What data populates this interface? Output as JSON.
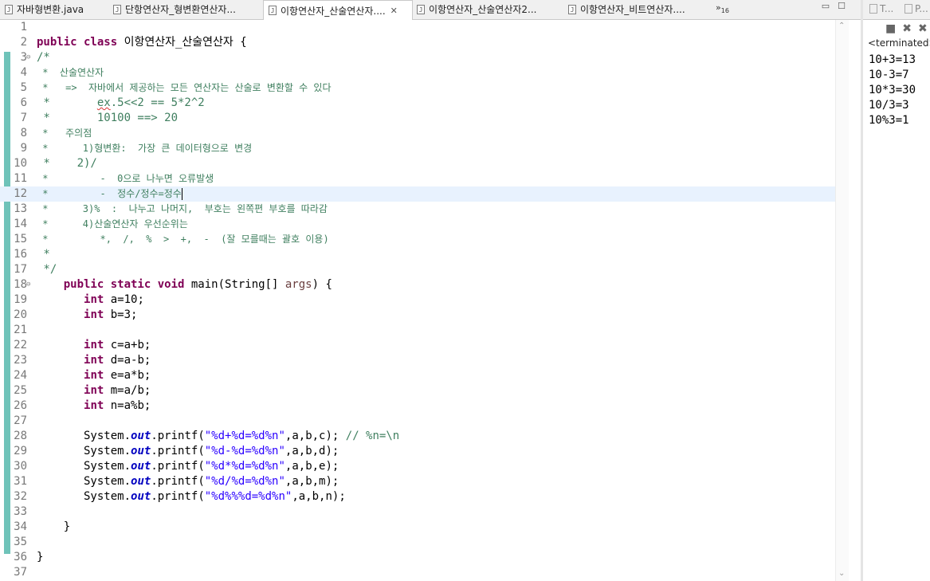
{
  "tabs": [
    {
      "label": "자바형변환.java",
      "icon": "java-file-icon"
    },
    {
      "label": "단항연산자_형변환연산자...",
      "icon": "java-file-icon"
    },
    {
      "label": "이항연산자_산술연산자....",
      "icon": "java-file-icon",
      "active": true
    },
    {
      "label": "이항연산자_산술연산자2...",
      "icon": "java-file-icon"
    },
    {
      "label": "이항연산자_비트연산자....",
      "icon": "java-file-icon"
    }
  ],
  "overflow": {
    "glyph": "»",
    "count": "16"
  },
  "editor": {
    "lines": [
      {
        "n": "1",
        "html": ""
      },
      {
        "n": "2",
        "html": "<span class='kw'>public class</span> 이항연산자_산술연산자 {"
      },
      {
        "n": "3",
        "fold": true,
        "html": "<span class='cm'>/*</span>"
      },
      {
        "n": "4",
        "comment": true,
        "html": "<span class='cm'> *  산술연산자</span>"
      },
      {
        "n": "5",
        "comment": true,
        "html": "<span class='cm'> *   =>  자바에서 제공하는 모든 연산자는 산술로 변환할 수 있다</span>"
      },
      {
        "n": "6",
        "html": "<span class='cm'> *       <span class='spell'>ex</span>.5&lt;&lt;2 == 5*2^2</span>"
      },
      {
        "n": "7",
        "html": "<span class='cm'> *       10100 ==&gt; 20</span>"
      },
      {
        "n": "8",
        "comment": true,
        "html": "<span class='cm'> *   주의점</span>"
      },
      {
        "n": "9",
        "comment": true,
        "html": "<span class='cm'> *      1)형변환:  가장 큰 데이터형으로 변경</span>"
      },
      {
        "n": "10",
        "html": "<span class='cm'> *    2)/</span>"
      },
      {
        "n": "11",
        "comment": true,
        "html": "<span class='cm'> *         -  0으로 나누면 오류발생</span>"
      },
      {
        "n": "12",
        "current": true,
        "comment": true,
        "html": "<span class='cm'> *         -  정수/정수=정수</span><span class='caret'></span>"
      },
      {
        "n": "13",
        "comment": true,
        "html": "<span class='cm'> *      3)%  :  나누고 나머지,  부호는 왼쪽편 부호를 따라감</span>"
      },
      {
        "n": "14",
        "comment": true,
        "html": "<span class='cm'> *      4)산술연산자 우선순위는</span>"
      },
      {
        "n": "15",
        "comment": true,
        "html": "<span class='cm'> *         *,  /,  %  &gt;  +,  -  (잘 모를때는 괄호 이용)</span>"
      },
      {
        "n": "16",
        "html": "<span class='cm'> *</span>"
      },
      {
        "n": "17",
        "html": "<span class='cm'> */</span>"
      },
      {
        "n": "18",
        "fold": true,
        "html": "    <span class='kw'>public static void</span> main(String[] <span class='arg'>args</span>) {"
      },
      {
        "n": "19",
        "html": "       <span class='kw'>int</span> a=10;"
      },
      {
        "n": "20",
        "html": "       <span class='kw'>int</span> b=3;"
      },
      {
        "n": "21",
        "html": ""
      },
      {
        "n": "22",
        "html": "       <span class='kw'>int</span> c=a+b;"
      },
      {
        "n": "23",
        "html": "       <span class='kw'>int</span> d=a-b;"
      },
      {
        "n": "24",
        "html": "       <span class='kw'>int</span> e=a*b;"
      },
      {
        "n": "25",
        "html": "       <span class='kw'>int</span> m=a/b;"
      },
      {
        "n": "26",
        "html": "       <span class='kw'>int</span> n=a%b;"
      },
      {
        "n": "27",
        "html": ""
      },
      {
        "n": "28",
        "html": "       System.<span class='fld'>out</span>.printf(<span class='str'>\"%d+%d=%d%n\"</span>,a,b,c); <span class='cm'>// %n=\\n</span>"
      },
      {
        "n": "29",
        "html": "       System.<span class='fld'>out</span>.printf(<span class='str'>\"%d-%d=%d%n\"</span>,a,b,d);"
      },
      {
        "n": "30",
        "html": "       System.<span class='fld'>out</span>.printf(<span class='str'>\"%d*%d=%d%n\"</span>,a,b,e);"
      },
      {
        "n": "31",
        "html": "       System.<span class='fld'>out</span>.printf(<span class='str'>\"%d/%d=%d%n\"</span>,a,b,m);"
      },
      {
        "n": "32",
        "html": "       System.<span class='fld'>out</span>.printf(<span class='str'>\"%d%%%d=%d%n\"</span>,a,b,n);"
      },
      {
        "n": "33",
        "html": ""
      },
      {
        "n": "34",
        "html": "    }"
      },
      {
        "n": "35",
        "html": ""
      },
      {
        "n": "36",
        "html": "}"
      },
      {
        "n": "37",
        "html": ""
      }
    ]
  },
  "console": {
    "tabs": [
      {
        "label": "T..."
      },
      {
        "label": "P..."
      }
    ],
    "status": "<terminated>",
    "output": [
      "10+3=13",
      "10-3=7",
      "10*3=30",
      "10/3=3",
      "10%3=1"
    ]
  },
  "colors": {
    "keyword": "#7f0055",
    "comment": "#3f7f5f",
    "string": "#2a00ff",
    "field": "#0000c0",
    "ruler": "#6fc3b9",
    "current_line": "#e8f2fe"
  }
}
